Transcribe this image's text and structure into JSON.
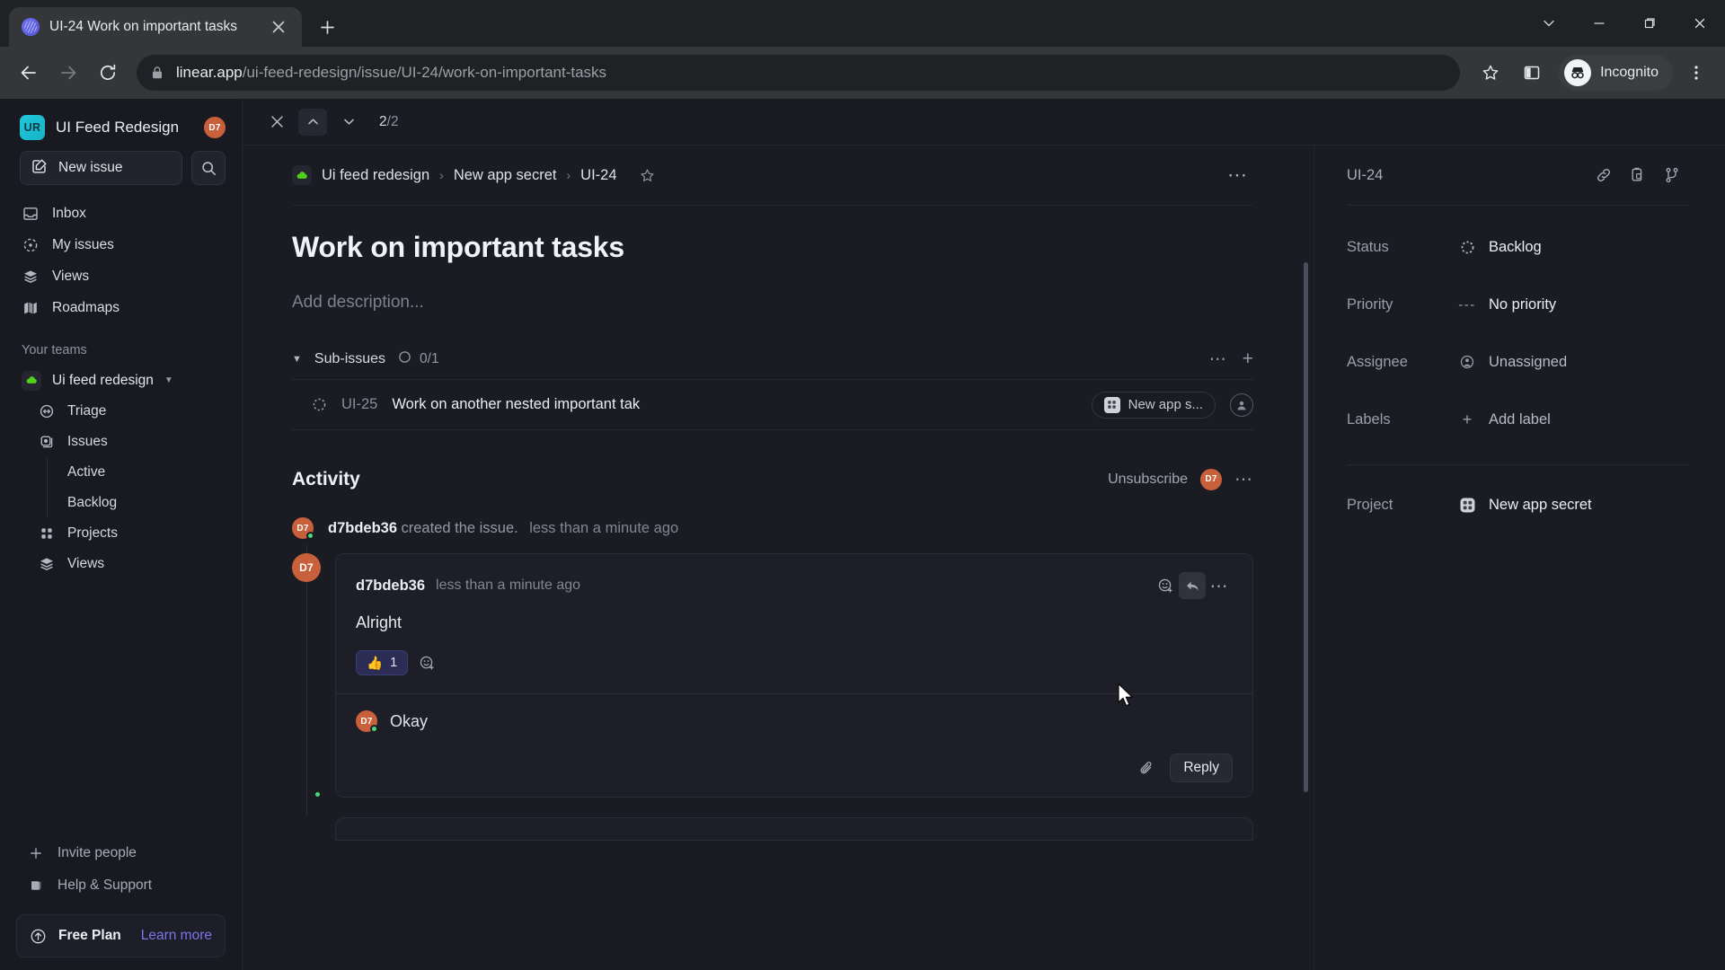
{
  "browser": {
    "tab": {
      "title": "UI-24 Work on important tasks",
      "favicon": "linear-logo-icon",
      "close": "×"
    },
    "new_tab_label": "+",
    "window_controls": [
      "chevron-down",
      "minimize",
      "maximize",
      "close"
    ],
    "url_domain": "linear.app",
    "url_path": "/ui-feed-redesign/issue/UI-24/work-on-important-tasks",
    "profile_label": "Incognito"
  },
  "sidebar": {
    "workspace": {
      "name": "UI Feed Redesign",
      "initials": "UR",
      "avatar": "D7"
    },
    "new_issue_label": "New issue",
    "nav": [
      {
        "label": "Inbox",
        "icon": "inbox-icon"
      },
      {
        "label": "My issues",
        "icon": "target-icon"
      },
      {
        "label": "Views",
        "icon": "layers-icon"
      },
      {
        "label": "Roadmaps",
        "icon": "map-icon"
      }
    ],
    "teams_label": "Your teams",
    "team": {
      "name": "Ui feed redesign",
      "icon": "cloud-icon"
    },
    "team_nav": [
      {
        "label": "Triage",
        "icon": "triage-icon"
      },
      {
        "label": "Issues",
        "icon": "issues-icon"
      }
    ],
    "team_leaves": [
      {
        "label": "Active"
      },
      {
        "label": "Backlog"
      }
    ],
    "team_nav2": [
      {
        "label": "Projects",
        "icon": "grid-icon"
      },
      {
        "label": "Views",
        "icon": "layers-icon"
      }
    ],
    "footer": [
      {
        "label": "Invite people",
        "icon": "plus-icon"
      },
      {
        "label": "Help & Support",
        "icon": "book-icon"
      }
    ],
    "plan": {
      "name": "Free Plan",
      "link": "Learn more",
      "icon": "arrow-up-circle-icon"
    }
  },
  "topnav": {
    "close_label": "×",
    "prev_label": "▲",
    "next_label": "▼",
    "position_current": "2",
    "position_sep": "/",
    "position_total": "2"
  },
  "issue": {
    "breadcrumb": {
      "team": "Ui feed redesign",
      "project": "New app secret",
      "id": "UI-24",
      "sep1": "›",
      "sep2": "›"
    },
    "title": "Work on important tasks",
    "description_placeholder": "Add description...",
    "subissues": {
      "caret": "▼",
      "label": "Sub-issues",
      "progress": "0/1",
      "more": "⋯",
      "add": "+",
      "rows": [
        {
          "id": "UI-25",
          "title": "Work on another nested important tak",
          "project_pill": "New app s...",
          "status_icon": "backlog-circle-icon",
          "assignee_icon": "user-circle-icon"
        }
      ]
    },
    "activity": {
      "title": "Activity",
      "unsubscribe": "Unsubscribe",
      "avatar": "D7",
      "more": "⋯",
      "created": {
        "user": "d7bdeb36",
        "action": "created the issue.",
        "time": "less than a minute ago",
        "avatar": "D7"
      },
      "comment": {
        "avatar": "D7",
        "user": "d7bdeb36",
        "time": "less than a minute ago",
        "body": "Alright",
        "reaction_emoji": "👍",
        "reaction_count": "1",
        "actions": [
          "emoji-icon",
          "reply-arrow-icon",
          "more-icon"
        ]
      },
      "reply_box": {
        "avatar": "D7",
        "text": "Okay",
        "attach_icon": "paperclip-icon",
        "reply_label": "Reply"
      }
    }
  },
  "properties": {
    "id": "UI-24",
    "header_icons": [
      "link-icon",
      "copy-icon",
      "branch-icon"
    ],
    "rows": [
      {
        "label": "Status",
        "value": "Backlog",
        "icon": "backlog-circle-icon"
      },
      {
        "label": "Priority",
        "value": "No priority",
        "icon": "dashes-icon"
      },
      {
        "label": "Assignee",
        "value": "Unassigned",
        "icon": "user-circle-icon"
      },
      {
        "label": "Labels",
        "value": "Add label",
        "icon": "plus-icon"
      }
    ],
    "project_row": {
      "label": "Project",
      "value": "New app secret",
      "icon": "project-grid-icon"
    }
  },
  "colors": {
    "accent": "#7a76e8",
    "avatar": "#c9603c",
    "online": "#49d977",
    "team_green": "#4fd11a",
    "reaction_bg": "#2b2d55",
    "bg": "#1b1c23",
    "sidebar_bg": "#191a21"
  }
}
